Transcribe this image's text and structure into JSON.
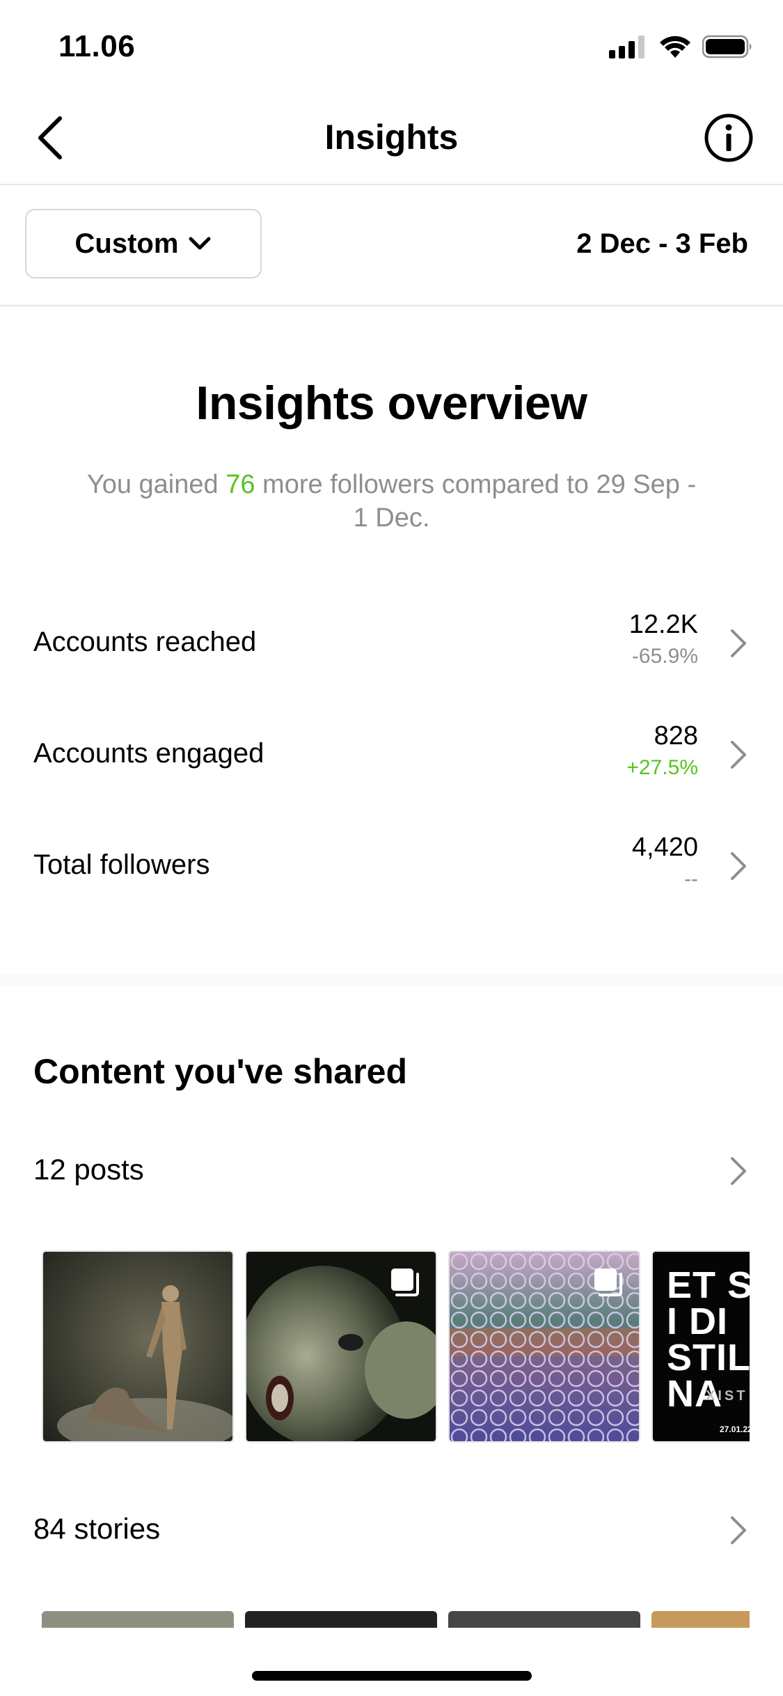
{
  "status_bar": {
    "time": "11.06"
  },
  "nav": {
    "title": "Insights"
  },
  "filter": {
    "custom_label": "Custom",
    "date_range": "2 Dec - 3 Feb"
  },
  "overview": {
    "title": "Insights overview",
    "subtitle_prefix": "You gained ",
    "subtitle_number": "76",
    "subtitle_suffix": " more followers compared to 29 Sep - 1 Dec."
  },
  "metrics": [
    {
      "label": "Accounts reached",
      "value": "12.2K",
      "delta": "-65.9%"
    },
    {
      "label": "Accounts engaged",
      "value": "828",
      "delta": "+27.5%"
    },
    {
      "label": "Total followers",
      "value": "4,420",
      "delta": "--"
    }
  ],
  "content": {
    "title": "Content you've shared",
    "posts_label": "12 posts",
    "stories_label": "84 stories",
    "posts": [
      {
        "kind": "statue-photo"
      },
      {
        "kind": "creature-photo",
        "multi": true
      },
      {
        "kind": "bead-curtain-photo",
        "multi": true
      },
      {
        "kind": "poster",
        "multi": false,
        "poster_lines": [
          "ET ST",
          "I DI",
          "STIL",
          "NA"
        ],
        "poster_small": "XIST",
        "poster_date": "27.01.22"
      }
    ]
  },
  "colors": {
    "positive": "#58c322",
    "muted": "#8e8e8e"
  }
}
